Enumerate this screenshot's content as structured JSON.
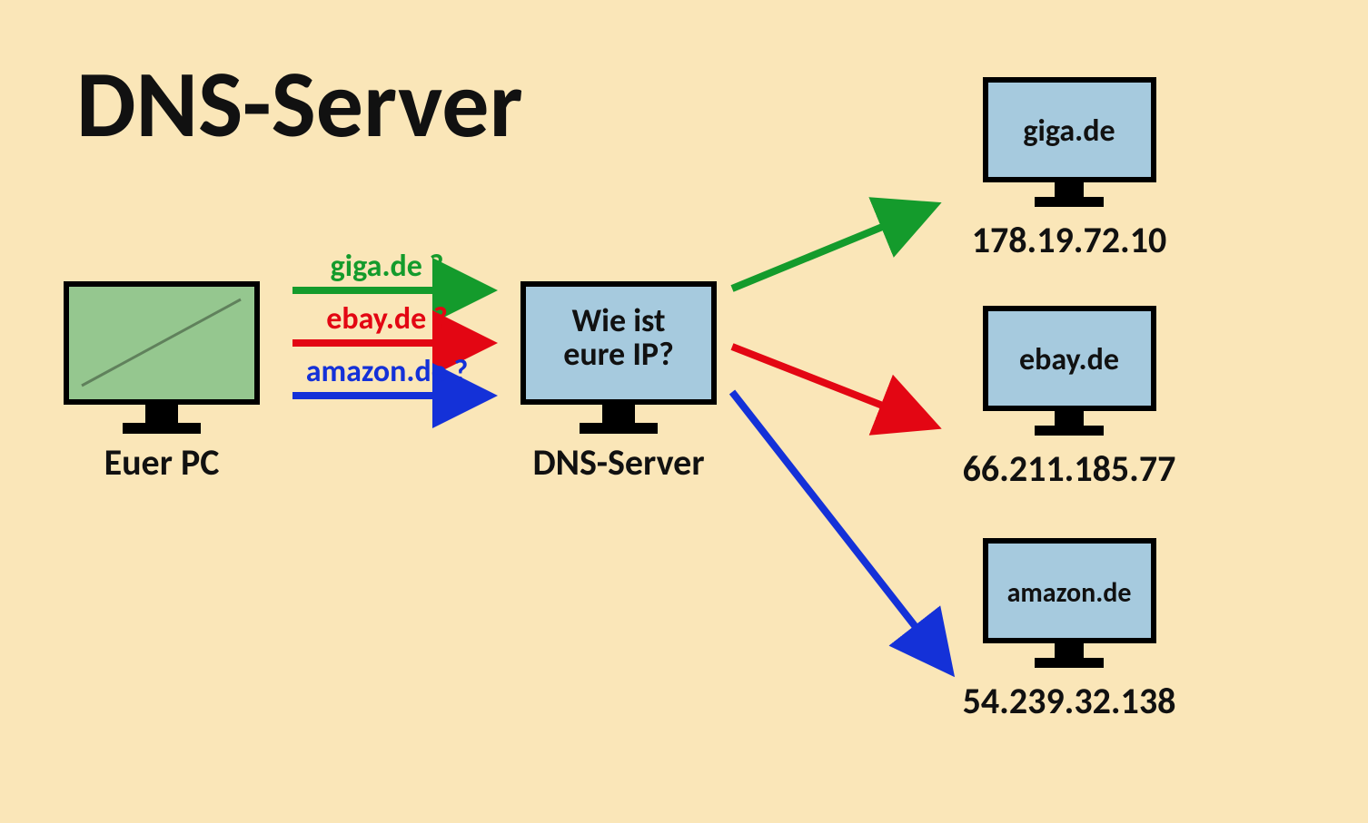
{
  "title": "DNS-Server",
  "pc": {
    "label": "Euer PC"
  },
  "dns": {
    "label": "DNS-Server",
    "screen_line1": "Wie ist",
    "screen_line2": "eure IP?"
  },
  "queries": {
    "giga": {
      "label": "giga.de ?",
      "color": "#149b2c"
    },
    "ebay": {
      "label": "ebay.de ?",
      "color": "#e30613"
    },
    "amazon": {
      "label": "amazon.de ?",
      "color": "#1431d8"
    }
  },
  "targets": {
    "giga": {
      "name": "giga.de",
      "ip": "178.19.72.10"
    },
    "ebay": {
      "name": "ebay.de",
      "ip": "66.211.185.77"
    },
    "amazon": {
      "name": "amazon.de",
      "ip": "54.239.32.138"
    }
  },
  "colors": {
    "bg": "#fae6b8",
    "pcScreen": "#95c78f",
    "blueScreen": "#a6cade",
    "stroke": "#000"
  }
}
